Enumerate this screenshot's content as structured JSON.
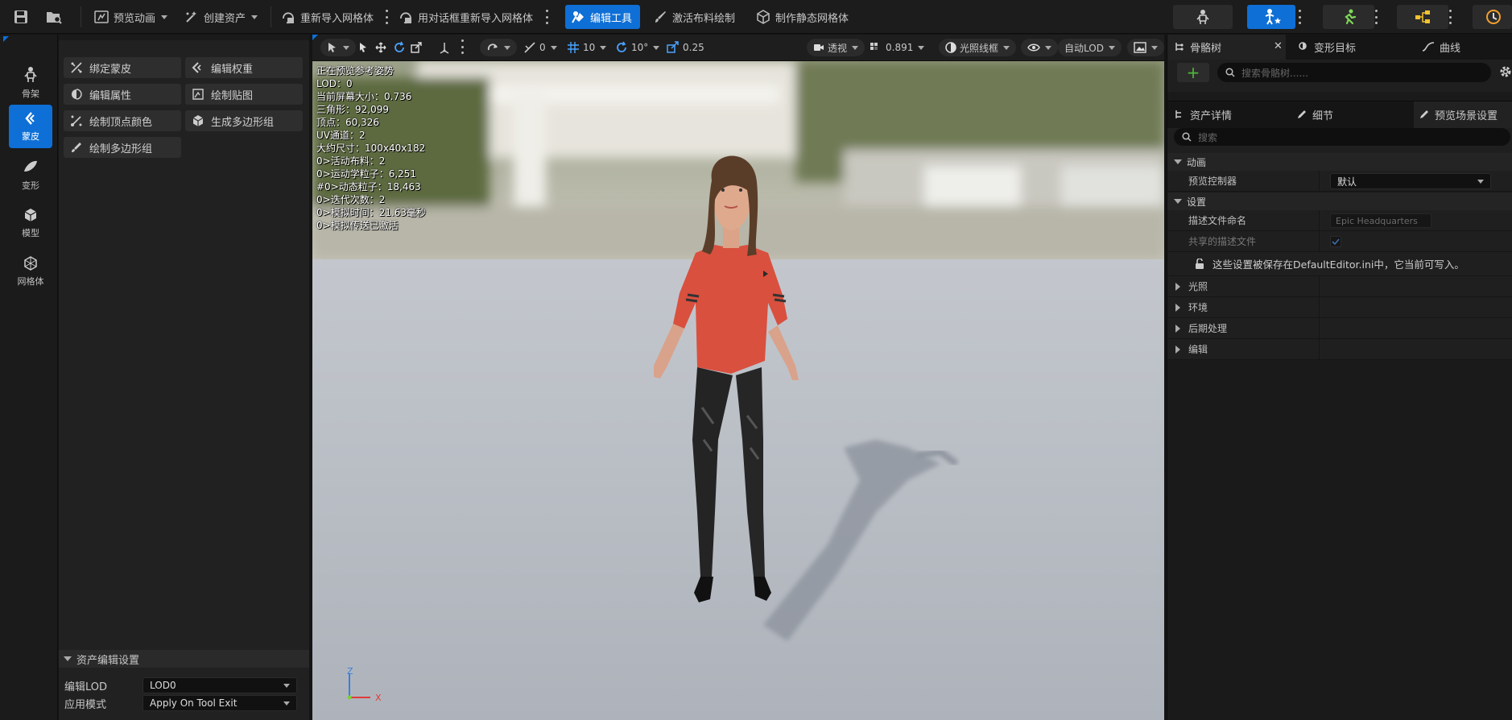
{
  "toolbar": {
    "preview_anim": "预览动画",
    "create_asset": "创建资产",
    "reimport_mesh": "重新导入网格体",
    "reimport_dialog": "用对话框重新导入网格体",
    "edit_tools": "编辑工具",
    "activate_cloth_paint": "激活布料绘制",
    "make_static_mesh": "制作静态网格体"
  },
  "modes": [
    {
      "label": "骨架",
      "icon": "skeleton-icon"
    },
    {
      "label": "蒙皮",
      "icon": "skin-icon",
      "selected": true
    },
    {
      "label": "变形",
      "icon": "deform-icon"
    },
    {
      "label": "模型",
      "icon": "model-icon"
    },
    {
      "label": "网格体",
      "icon": "mesh-icon"
    }
  ],
  "tools": [
    "绑定蒙皮",
    "编辑权重",
    "编辑属性",
    "绘制贴图",
    "绘制顶点颜色",
    "生成多边形组",
    "绘制多边形组"
  ],
  "asset_settings": {
    "header": "资产编辑设置",
    "edit_lod_label": "编辑LOD",
    "edit_lod_value": "LOD0",
    "apply_mode_label": "应用模式",
    "apply_mode_value": "Apply On Tool Exit"
  },
  "viewport_toolbar": {
    "rot_snap": "0",
    "grid_snap": "10",
    "angle_snap": "10°",
    "scale_snap": "0.25",
    "perspective": "透视",
    "screen_pct": "0.891",
    "lighting": "光照线框",
    "lod": "自动LOD"
  },
  "viewport_stats": [
    "正在预览参考姿势",
    "LOD：0",
    "当前屏幕大小：0.736",
    "三角形：92,099",
    "顶点：60,326",
    "UV通道：2",
    "大约尺寸：100x40x182",
    "0>活动布料：2",
    "0>运动学粒子：6,251",
    "#0>动态粒子：18,463",
    "0>迭代次数：2",
    "0>模拟时间：21.63毫秒",
    "0>模拟传送已激活"
  ],
  "axis": {
    "z": "Z",
    "x": "X"
  },
  "right_panel": {
    "tabs": [
      "骨骼树",
      "变形目标",
      "曲线"
    ],
    "search_skeleton_placeholder": "搜索骨骼树......",
    "detail_tabs": [
      "资产详情",
      "细节",
      "预览场景设置"
    ],
    "search_placeholder": "搜索",
    "sections": {
      "animation": "动画",
      "preview_controller_label": "预览控制器",
      "preview_controller_value": "默认",
      "settings": "设置",
      "profile_name_label": "描述文件命名",
      "profile_name_value": "Epic Headquarters",
      "shared_profile_label": "共享的描述文件",
      "info": "这些设置被保存在DefaultEditor.ini中，它当前可写入。",
      "lighting": "光照",
      "environment": "环境",
      "post_process": "后期处理",
      "edit": "编辑"
    }
  },
  "colors": {
    "accent": "#0e6fd6",
    "bg": "#1a1a1a",
    "add_green": "#4fb83a"
  }
}
